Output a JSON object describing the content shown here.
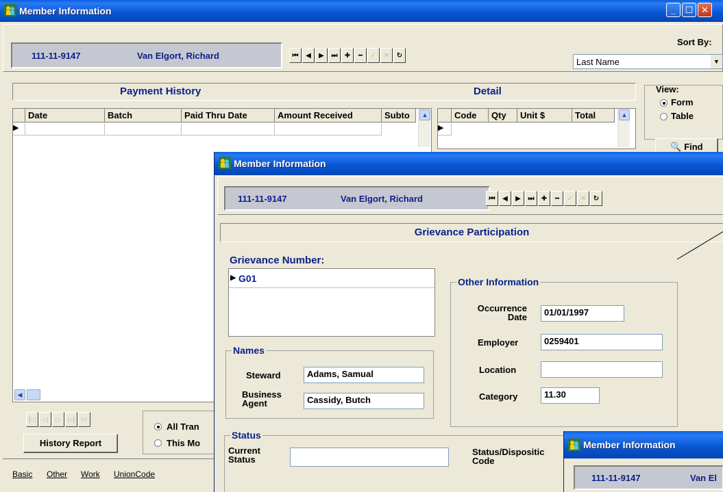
{
  "window": {
    "title": "Member Information",
    "member_id": "111-11-9147",
    "member_name": "Van Elgort, Richard",
    "sort_by_label": "Sort By:",
    "sort_by_value": "Last Name",
    "payment_history_title": "Payment History",
    "detail_title": "Detail",
    "payment_columns": [
      "Date",
      "Batch",
      "Paid Thru Date",
      "Amount Received",
      "Subto"
    ],
    "detail_columns": [
      "Code",
      "Qty",
      "Unit $",
      "Total"
    ],
    "view_label": "View:",
    "view_options": [
      "Form",
      "Table"
    ],
    "find_label": "Find",
    "history_report_label": "History Report",
    "trans_options": [
      "All Tran",
      "This Mo"
    ],
    "tabs": [
      "Basic",
      "Other",
      "Work",
      "UnionCode"
    ]
  },
  "grievance": {
    "title": "Member Information",
    "member_id": "111-11-9147",
    "member_name": "Van Elgort, Richard",
    "section_title": "Grievance Participation",
    "grievance_number_label": "Grievance Number:",
    "grievance_numbers": [
      "G01"
    ],
    "names_group": "Names",
    "steward_label": "Steward",
    "steward_value": "Adams, Samual",
    "business_agent_label": "Business Agent",
    "business_agent_value": "Cassidy, Butch",
    "other_info_group": "Other Information",
    "occurrence_date_label": "Occurrence Date",
    "occurrence_date_value": "01/01/1997",
    "employer_label": "Employer",
    "employer_value": "0259401",
    "location_label": "Location",
    "location_value": "",
    "category_label": "Category",
    "category_value": "11.30",
    "status_group": "Status",
    "current_status_label": "Current Status",
    "current_status_value": "",
    "status_disposition_label": "Status/Dispositic Code"
  },
  "third": {
    "title": "Member Information",
    "member_id": "111-11-9147",
    "member_name_partial": "Van El"
  },
  "colors": {
    "title_blue": "#0858d4",
    "label_navy": "#0b1f8a",
    "face": "#ece9d8",
    "record_panel": "#c5c8d0"
  }
}
